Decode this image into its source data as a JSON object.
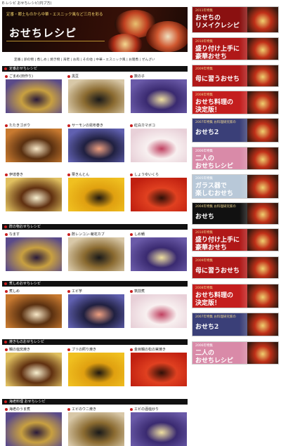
{
  "breadcrumb": "E-レシピ おせちレシピ(円ブ方)",
  "hero": {
    "subtitle": "定番・郷土ものから中華・エスニック風など三月を彩る",
    "title": "おせちレシピ"
  },
  "category_nav": [
    "定番",
    "卵の物",
    "煮しめ",
    "焼き物",
    "海老",
    "お肉",
    "その他",
    "中華・エスニック風",
    "お雑煮",
    "ぜんざい"
  ],
  "sections": [
    {
      "title": "定番おせちレシピ",
      "items": [
        "ごまめ(田作り)",
        "黒豆",
        "数の子",
        "たたきゴボウ",
        "サーモンの昆布巻き",
        "紅白カマボコ",
        "伊達巻き",
        "栗きんとん",
        "しょうゆいくら"
      ]
    },
    {
      "title": "酢の物おせちレシピ",
      "items": [
        "なます",
        "酢レンコン-菊花カブ",
        "しめ鯖"
      ]
    },
    {
      "title": "煮しめおせちレシピ",
      "items": [
        "煮しめ",
        "エビ芋",
        "筑前煮"
      ]
    },
    {
      "title": "焼きものおせちレシピ",
      "items": [
        "鯛の塩窯焼き",
        "ブリの照り焼き",
        "金目鯛の松の実焼き"
      ]
    },
    {
      "title": "海老料理 おせちレシピ",
      "items": [
        "海老のうま煮",
        "エビのウニ焼き",
        "エビの酒塩炒り"
      ]
    }
  ],
  "banners": [
    {
      "small": "2011年特集",
      "big": "おせちの",
      "big2": "リメイクレシピ",
      "color": "#8a1010"
    },
    {
      "small": "2010年特集",
      "big": "盛り付け上手に",
      "big2": "豪華おせち",
      "color": "#b01818"
    },
    {
      "small": "2009年特集",
      "big": "母に習うおせち",
      "big2": "",
      "color": "#b01818"
    },
    {
      "small": "2008年特集",
      "big": "おせち料理の",
      "big2": "決定版！",
      "color": "#c41e1e"
    },
    {
      "small": "2007年特集 お料理研究家の",
      "big": "おせち2",
      "big2": "",
      "color": "#3a3f78"
    },
    {
      "small": "2006年特集",
      "big": "二人の",
      "big2": "おせちレシピ",
      "color": "#d98aa8"
    },
    {
      "small": "2005年特集",
      "big": "ガラス器で",
      "big2": "楽しむおせち",
      "color": "#b8c8d8"
    },
    {
      "small": "2004年特集 お料理研究家の",
      "big": "おせち",
      "big2": "",
      "color": "#111111"
    },
    {
      "small": "2010年特集",
      "big": "盛り付け上手に",
      "big2": "豪華おせち",
      "color": "#b01818"
    },
    {
      "small": "2009年特集",
      "big": "母に習うおせち",
      "big2": "",
      "color": "#b01818"
    },
    {
      "small": "2008年特集",
      "big": "おせち料理の",
      "big2": "決定版！",
      "color": "#c41e1e"
    },
    {
      "small": "2007年特集 お料理研究家の",
      "big": "おせち2",
      "big2": "",
      "color": "#3a3f78"
    },
    {
      "small": "2006年特集",
      "big": "二人の",
      "big2": "おせちレシピ",
      "color": "#d98aa8"
    }
  ]
}
